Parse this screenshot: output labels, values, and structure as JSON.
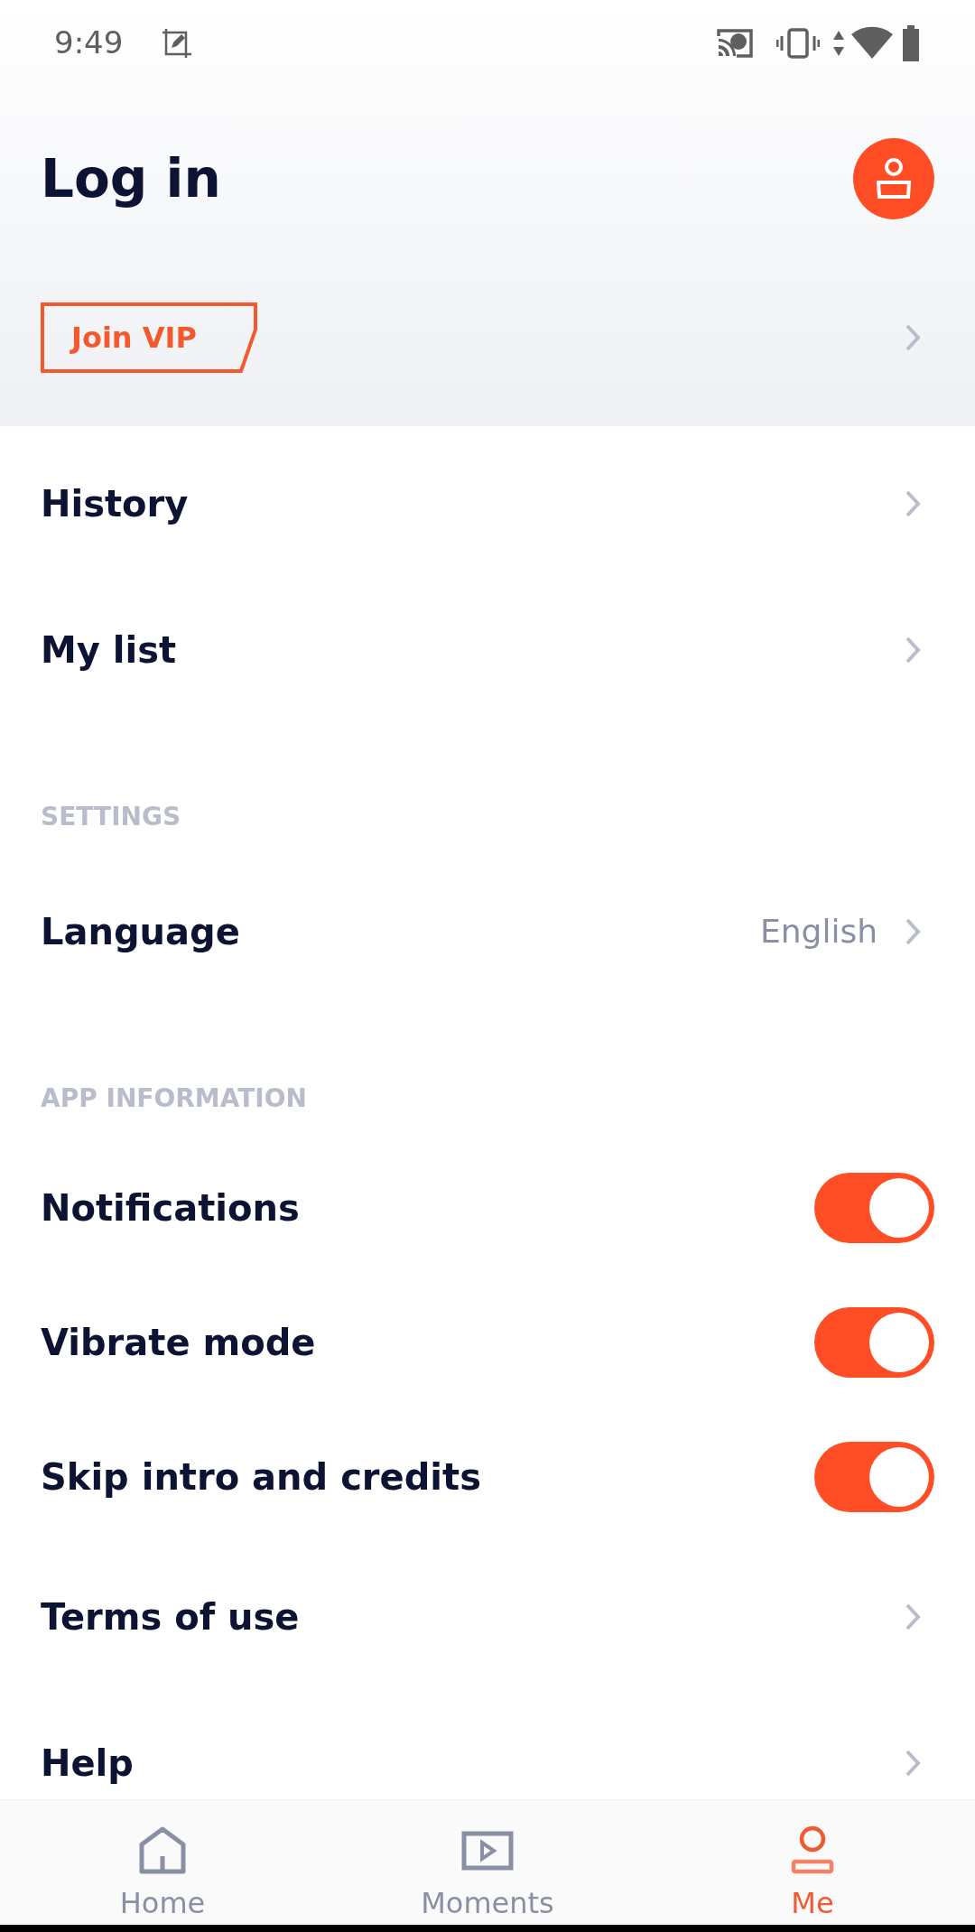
{
  "status_bar": {
    "time": "9:49"
  },
  "header": {
    "title": "Log in",
    "vip_button": "Join VIP"
  },
  "items": [
    {
      "kind": "link",
      "label": "History"
    },
    {
      "kind": "link",
      "label": "My list"
    },
    {
      "kind": "section",
      "label": "SETTINGS"
    },
    {
      "kind": "link",
      "label": "Language",
      "value": "English"
    },
    {
      "kind": "section",
      "label": "APP INFORMATION"
    },
    {
      "kind": "toggle",
      "label": "Notifications",
      "on": true
    },
    {
      "kind": "toggle",
      "label": "Vibrate mode",
      "on": true
    },
    {
      "kind": "toggle",
      "label": "Skip intro and credits",
      "on": true
    },
    {
      "kind": "link",
      "label": "Terms of use"
    },
    {
      "kind": "link",
      "label": "Help"
    }
  ],
  "tabs": [
    {
      "kind": "home",
      "label": "Home",
      "selected": false
    },
    {
      "kind": "moments",
      "label": "Moments",
      "selected": false
    },
    {
      "kind": "me",
      "label": "Me",
      "selected": true
    }
  ]
}
